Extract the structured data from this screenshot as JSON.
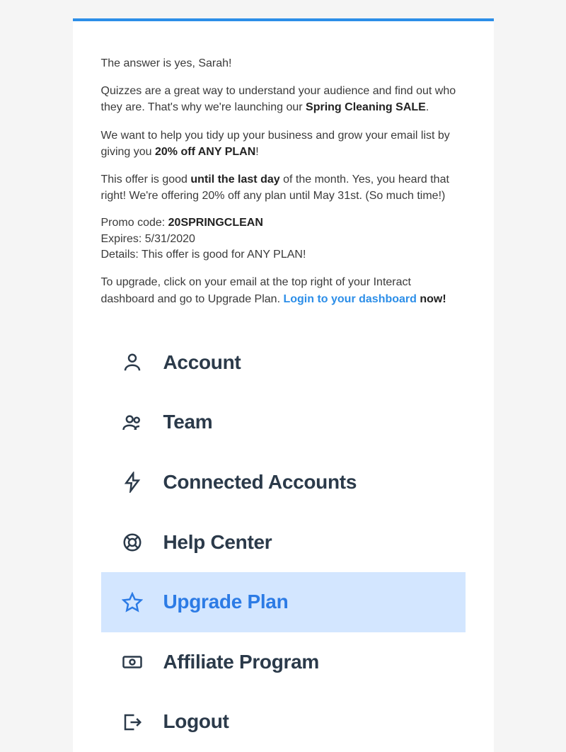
{
  "greeting": "The answer is yes,  Sarah!",
  "para1_a": "Quizzes are a great way to understand your audience and find out who they are. That's why we're launching our ",
  "para1_bold": "Spring Cleaning SALE",
  "para1_c": ".",
  "para2_a": "We want to help you tidy up your business and grow your email list by giving you ",
  "para2_bold": "20% off ANY PLAN",
  "para2_c": "!",
  "para3_a": "This offer is good ",
  "para3_bold": "until the last day",
  "para3_c": " of the month. Yes, you heard that right! We're offering 20% off any plan until May 31st. (So much time!)",
  "promo": {
    "code_label": "Promo code: ",
    "code": "20SPRINGCLEAN",
    "expires": "Expires: 5/31/2020",
    "details": "Details: This offer is good for ANY PLAN!"
  },
  "para4_a": "To upgrade, click on your email at the top right of your Interact dashboard and go to Upgrade Plan. ",
  "para4_link": "Login to your dashboard",
  "para4_c": " now!",
  "menu": {
    "items": [
      {
        "label": "Account",
        "icon": "person-icon"
      },
      {
        "label": "Team",
        "icon": "team-icon"
      },
      {
        "label": "Connected Accounts",
        "icon": "bolt-icon"
      },
      {
        "label": "Help Center",
        "icon": "lifebuoy-icon"
      },
      {
        "label": "Upgrade Plan",
        "icon": "star-icon",
        "highlight": true
      },
      {
        "label": "Affiliate Program",
        "icon": "money-icon"
      },
      {
        "label": "Logout",
        "icon": "logout-icon"
      }
    ]
  }
}
